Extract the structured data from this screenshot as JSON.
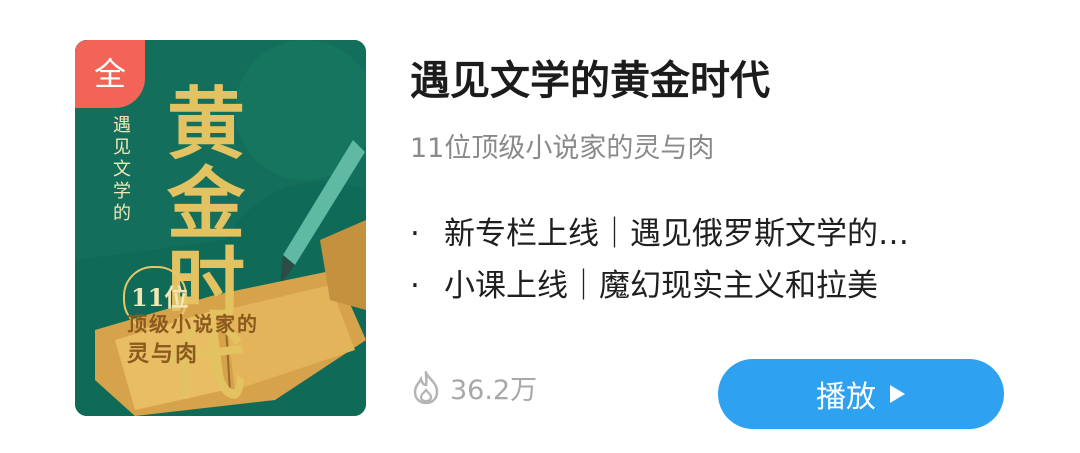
{
  "cover": {
    "badge": "全",
    "small_text": "遇见文学的",
    "big_text": "黄金时代",
    "count_text": "11位",
    "sub_line1": "顶级小说家的",
    "sub_line2": "灵与肉",
    "colors": {
      "background": "#0f6b58",
      "gold": "#e3c262",
      "badge": "#f26457"
    }
  },
  "course": {
    "title": "遇见文学的黄金时代",
    "subtitle": "11位顶级小说家的灵与肉",
    "updates": [
      {
        "bullet": "·",
        "text": "新专栏上线｜遇见俄罗斯文学的…"
      },
      {
        "bullet": "·",
        "text": "小课上线｜魔幻现实主义和拉美"
      }
    ],
    "plays": "36.2万",
    "play_label": "播放"
  },
  "icons": {
    "plays": "flame-icon",
    "play": "play-icon"
  },
  "accent": "#2ea1f1"
}
